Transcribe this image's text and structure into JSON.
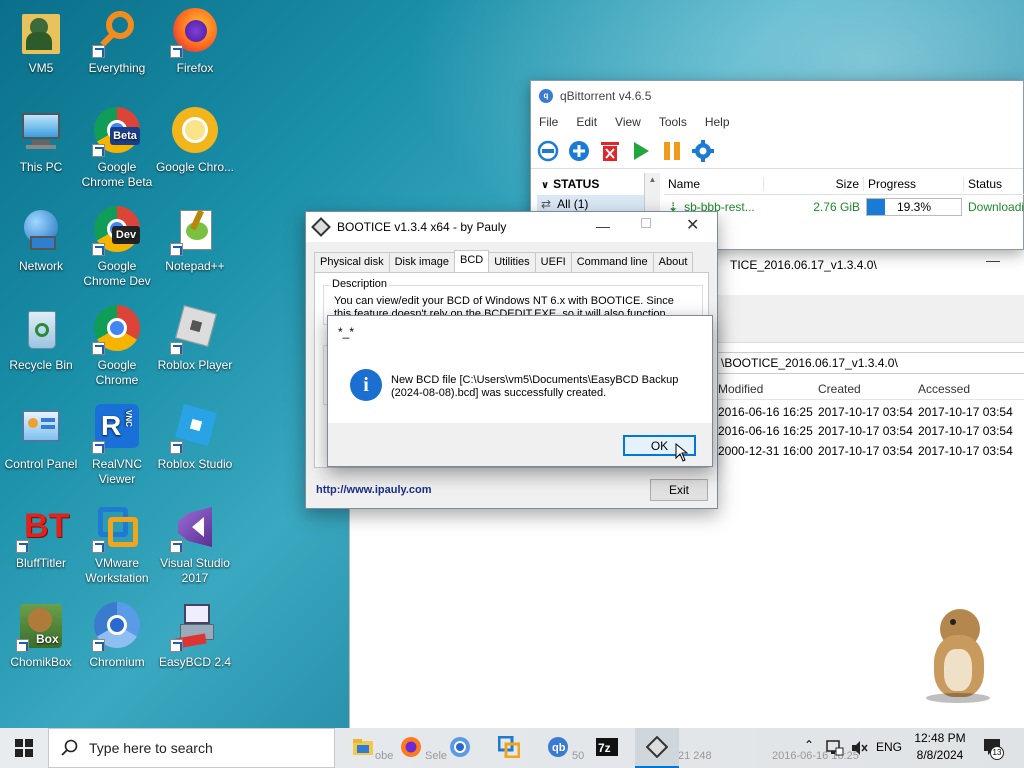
{
  "desktop": {
    "icons": [
      {
        "label": "VM5"
      },
      {
        "label": "Everything"
      },
      {
        "label": "Firefox"
      },
      {
        "label": "This PC"
      },
      {
        "label": "Google Chrome Beta"
      },
      {
        "label": "Google Chro..."
      },
      {
        "label": "Network"
      },
      {
        "label": "Google Chrome Dev"
      },
      {
        "label": "Notepad++"
      },
      {
        "label": "Recycle Bin"
      },
      {
        "label": "Google Chrome"
      },
      {
        "label": "Roblox Player"
      },
      {
        "label": "Control Panel"
      },
      {
        "label": "RealVNC Viewer"
      },
      {
        "label": "Roblox Studio"
      },
      {
        "label": "BluffTitler"
      },
      {
        "label": "VMware Workstation"
      },
      {
        "label": "Visual Studio 2017"
      },
      {
        "label": "ChomikBox"
      },
      {
        "label": "Chromium"
      },
      {
        "label": "EasyBCD 2.4"
      }
    ]
  },
  "qbittorrent": {
    "title": "qBittorrent v4.6.5",
    "menu": [
      "File",
      "Edit",
      "View",
      "Tools",
      "Help"
    ],
    "status_header": "STATUS",
    "filter_all": "All (1)",
    "columns": {
      "name": "Name",
      "size": "Size",
      "progress": "Progress",
      "status": "Status"
    },
    "torrent": {
      "name": "sb-bbb-rest...",
      "size": "2.76 GiB",
      "progress": "19.3%",
      "progress_value": 0.193,
      "status": "Downloadi"
    }
  },
  "explorer": {
    "title_fragment": "TICE_2016.06.17_v1.3.4.0\\",
    "path": "\\BOOTICE_2016.06.17_v1.3.4.0\\",
    "columns": {
      "modified": "Modified",
      "created": "Created",
      "accessed": "Accessed"
    },
    "rows": [
      {
        "modified": "2016-06-16 16:25",
        "created": "2017-10-17 03:54",
        "accessed": "2017-10-17 03:54"
      },
      {
        "modified": "2016-06-16 16:25",
        "created": "2017-10-17 03:54",
        "accessed": "2017-10-17 03:54"
      },
      {
        "modified": "2000-12-31 16:00",
        "created": "2017-10-17 03:54",
        "accessed": "2017-10-17 03:54"
      }
    ],
    "bottom_fragments": [
      "21 248",
      "2016-06-16 16:25"
    ]
  },
  "bootice": {
    "title": "BOOTICE v1.3.4 x64 - by Pauly",
    "tabs": [
      "Physical disk",
      "Disk image",
      "BCD",
      "Utilities",
      "UEFI",
      "Command line",
      "About"
    ],
    "description_label": "Description",
    "description_text": "You can view/edit your BCD of Windows NT 6.x with BOOTICE. Since this feature doesn't rely on the BCDEDIT.EXE, so it will also function under",
    "link": "http://www.ipauly.com",
    "exit_label": "Exit"
  },
  "msgbox": {
    "title": "*_*",
    "message": "New BCD file [C:\\Users\\vm5\\Documents\\EasyBCD Backup (2024-08-08).bcd] was successfully created.",
    "ok_label": "OK"
  },
  "taskbar": {
    "search_placeholder": "Type here to search",
    "language": "ENG",
    "time": "12:48 PM",
    "date": "8/8/2024",
    "notification_count": "13",
    "behind_fragments": [
      "obe",
      "Sele",
      "50"
    ]
  }
}
